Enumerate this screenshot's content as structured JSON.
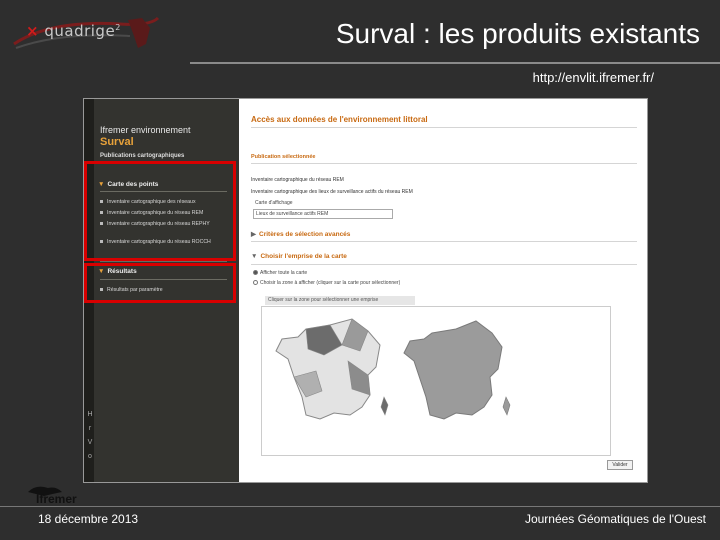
{
  "slide": {
    "logo_text": "quadrige",
    "logo_sup": "2",
    "title": "Surval : les produits existants",
    "url": "http://envlit.ifremer.fr/",
    "footer_date": "18 décembre 2013",
    "footer_event": "Journées Géomatiques de l'Ouest",
    "footer_logo": "Ifremer"
  },
  "screenshot": {
    "sidebar": {
      "brand": "Ifremer environnement",
      "app_name": "Surval",
      "publications": "Publications cartographiques",
      "section_carte": "Carte des points",
      "carte_items": [
        "Inventaire cartographique des réseaux",
        "Inventaire cartographique du réseau REM",
        "Inventaire cartographique du réseau REPHY",
        "Inventaire cartographique du réseau ROCCH"
      ],
      "section_resultats": "Résultats",
      "resultats_items": [
        "Résultats par paramètre"
      ],
      "vertical_letters": [
        "H",
        "r",
        "V",
        "o"
      ]
    },
    "main": {
      "title": "Accès aux données de l'environnement littoral",
      "subtitle": "Publication sélectionnée",
      "line1": "Inventaire cartographique du réseau REM",
      "line2": "Inventaire cartographique des lieux de surveillance actifs du réseau REM",
      "select_label": "Carte d'affichage",
      "select_value": "Lieux de surveillance actifs REM",
      "section_criteres": "Critères de sélection avancés",
      "section_emprise": "Choisir l'emprise de la carte",
      "radio1": "Afficher toute la carte",
      "radio2": "Choisir la zone à afficher (cliquer sur la carte pour sélectionner)",
      "map_hint": "Cliquer sur la zone pour sélectionner une emprise",
      "button": "Valider"
    }
  }
}
